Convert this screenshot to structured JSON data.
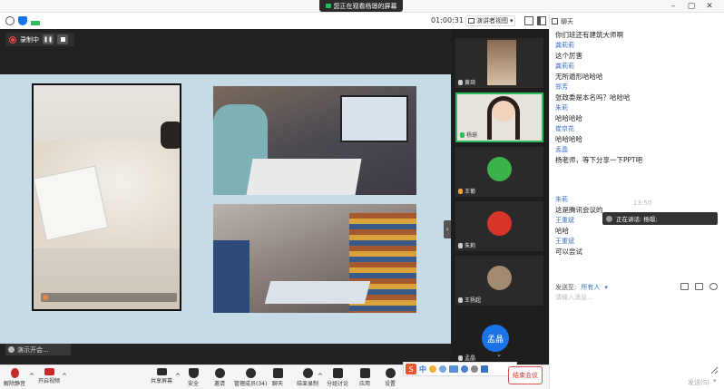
{
  "titlebar": {
    "sharing_text": "您正在观看杨璟的屏幕"
  },
  "toolbar": {
    "timer": "01:00:31",
    "view_label": "演讲者视图"
  },
  "share": {
    "rec_label": "录制中",
    "speaking_label": "演示开会…"
  },
  "participants": [
    {
      "name": "黄琦"
    },
    {
      "name": "杨璟"
    },
    {
      "name": "王葡"
    },
    {
      "name": "朱莉"
    },
    {
      "name": "王扬超"
    },
    {
      "name": "孟晶",
      "avatar_text": "孟晶"
    }
  ],
  "chat": {
    "title": "聊天",
    "messages": [
      {
        "sender": "",
        "text": "你们班还有建筑大师啊"
      },
      {
        "sender": "龚莉莉",
        "text": "这个厉害"
      },
      {
        "sender": "龚莉莉",
        "text": "无所遁形哈哈哈"
      },
      {
        "sender": "郑芳",
        "text": "张政委是本名吗？哈哈哈"
      },
      {
        "sender": "朱莉",
        "text": "哈哈哈哈"
      },
      {
        "sender": "崔京花",
        "text": "哈哈哈哈"
      },
      {
        "sender": "孟晶",
        "text": "杨老师，等下分享一下PPT吧"
      }
    ],
    "time": "13:50",
    "messages2": [
      {
        "sender": "朱莉",
        "text": "这是腾讯会议的"
      },
      {
        "sender": "王重斌",
        "text": "哈哈"
      },
      {
        "sender": "王重斌",
        "text": "可以尝试"
      }
    ],
    "speaking_toast": "正在讲话: 杨璟;",
    "send_to_label": "发送至:",
    "send_to_value": "所有人",
    "input_placeholder": "请输入消息...",
    "send_label": "发送(S)"
  },
  "bottom": {
    "buttons": [
      {
        "label": "解除静音"
      },
      {
        "label": "开启视频"
      },
      {
        "label": "共享屏幕"
      },
      {
        "label": "安全"
      },
      {
        "label": "邀请"
      },
      {
        "label": "管理成员(34)"
      },
      {
        "label": "聊天"
      },
      {
        "label": "结束录制"
      },
      {
        "label": "分组讨论"
      },
      {
        "label": "应用"
      },
      {
        "label": "设置"
      }
    ],
    "end_label": "结束会议"
  },
  "ime": {
    "logo": "S",
    "mode": "中"
  },
  "colors": {
    "accent": "#2bbf5e",
    "link": "#3a72c4",
    "danger": "#e03030"
  }
}
